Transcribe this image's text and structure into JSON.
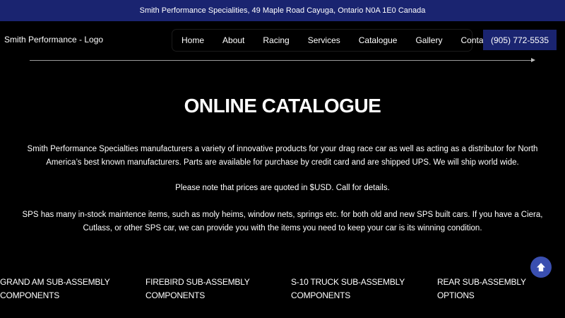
{
  "topbar": {
    "address": "Smith Performance Specialities, 49 Maple Road Cayuga, Ontario N0A 1E0 Canada"
  },
  "header": {
    "logo_text": "Smith Performance - Logo",
    "phone": "(905) 772-5535"
  },
  "nav": {
    "items": [
      {
        "label": "Home"
      },
      {
        "label": "About"
      },
      {
        "label": "Racing"
      },
      {
        "label": "Services"
      },
      {
        "label": "Catalogue"
      },
      {
        "label": "Gallery"
      },
      {
        "label": "Contact"
      }
    ]
  },
  "main": {
    "title": "ONLINE CATALOGUE",
    "paragraphs": [
      "Smith Performance Specialties manufacturers a variety of innovative products for your drag race car as well as acting as a distributor for North America’s best known manufacturers. Parts are available for purchase by credit card and are shipped UPS. We will ship world wide.",
      "Please note that prices are quoted in $USD. Call for details.",
      "SPS has many in-stock maintence items, such as moly heims, window nets, springs etc. for both old and new SPS built cars. If you have a Ciera, Cutlass, or other SPS car, we can provide you with the items you need to keep your car is its winning condition."
    ],
    "categories": [
      {
        "label": "GRAND AM SUB-ASSEMBLY COMPONENTS"
      },
      {
        "label": "FIREBIRD SUB-ASSEMBLY COMPONENTS"
      },
      {
        "label": "S-10 TRUCK SUB-ASSEMBLY COMPONENTS"
      },
      {
        "label": "REAR SUB-ASSEMBLY OPTIONS"
      }
    ]
  },
  "icons": {
    "scroll_top": "arrow-up-icon"
  },
  "colors": {
    "brand_navy": "#1a2470",
    "scroll_button": "#3a4fb0",
    "background": "#000000"
  }
}
